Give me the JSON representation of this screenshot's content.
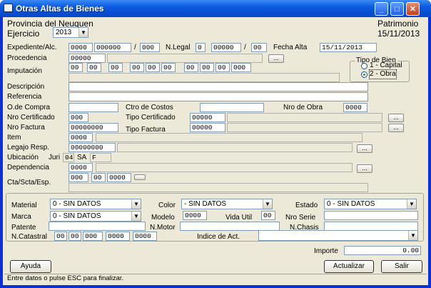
{
  "window": {
    "title": "Otras Altas de Bienes"
  },
  "header": {
    "province": "Provincia del Neuquen",
    "module": "Patrimonio",
    "date": "15/11/2013",
    "ejercicio_label": "Ejercicio",
    "ejercicio_value": "2013"
  },
  "form": {
    "expediente_label": "Expediente/Alc.",
    "exp1": "0000",
    "exp2": "000000",
    "exp_slash": "/",
    "exp3": "000",
    "nlegal_label": "N.Legal",
    "nl1": "0",
    "nl2": "00000",
    "nl_slash": "/",
    "nl3": "00",
    "fecha_alta_label": "Fecha Alta",
    "fecha_alta": "15/11/2013",
    "procedencia_label": "Procedencia",
    "procedencia_code": "00000",
    "imputacion_label": "Imputación",
    "imp": [
      "00",
      "00",
      "00",
      "00",
      "00",
      "00",
      "00",
      "00",
      "00",
      "000"
    ],
    "tipo_bien_label": "Tipo de Bien",
    "tipo_bien_opt1": "1 - Capital",
    "tipo_bien_opt2": "2 - Obra",
    "descripcion_label": "Descripción",
    "referencia_label": "Referencia",
    "ocompra_label": "O.de Compra",
    "ctro_costos_label": "Ctro de Costos",
    "nro_obra_label": "Nro de Obra",
    "nro_obra": "0000",
    "nro_cert_label": "Nro Certificado",
    "nro_cert": "000",
    "tipo_cert_label": "Tipo Certificado",
    "tipo_cert": "00000",
    "nro_factura_label": "Nro Factura",
    "nro_factura": "00000000",
    "tipo_factura_label": "Tipo Factura",
    "tipo_factura": "00000",
    "item_label": "Item",
    "item": "0000",
    "legajo_label": "Legajo Resp.",
    "legajo": "00000000",
    "ubicacion_label": "Ubicación",
    "juri_label": "Juri",
    "juri": "04",
    "sa_label": "SA",
    "sa": "F",
    "dependencia_label": "Dependencia",
    "dependencia": "0000",
    "cta_label": "Cta/Scta/Esp.",
    "cta": "000",
    "scta": "00",
    "esp": "0000",
    "dots": "..."
  },
  "detail": {
    "material_label": "Material",
    "material_value": "0 - SIN DATOS",
    "color_label": "Color",
    "color_value": "- SIN DATOS",
    "estado_label": "Estado",
    "estado_value": "0 - SIN DATOS",
    "marca_label": "Marca",
    "marca_value": "0 - SIN DATOS",
    "modelo_label": "Modelo",
    "modelo": "0000",
    "vida_util_label": "Vida Util",
    "vida_util": "00",
    "nro_serie_label": "Nro Serie",
    "patente_label": "Patente",
    "nmotor_label": "N.Motor",
    "nchasis_label": "N.Chasis",
    "ncatastral_label": "N.Catastral",
    "ncat": [
      "00",
      "00",
      "000",
      "0000",
      "0000"
    ],
    "indice_label": "Indice de Act."
  },
  "importe": {
    "label": "Importe",
    "value": "0.00"
  },
  "buttons": {
    "ayuda": "Ayuda",
    "actualizar": "Actualizar",
    "salir": "Salir"
  },
  "status": "Entre datos o pulse ESC para finalizar."
}
